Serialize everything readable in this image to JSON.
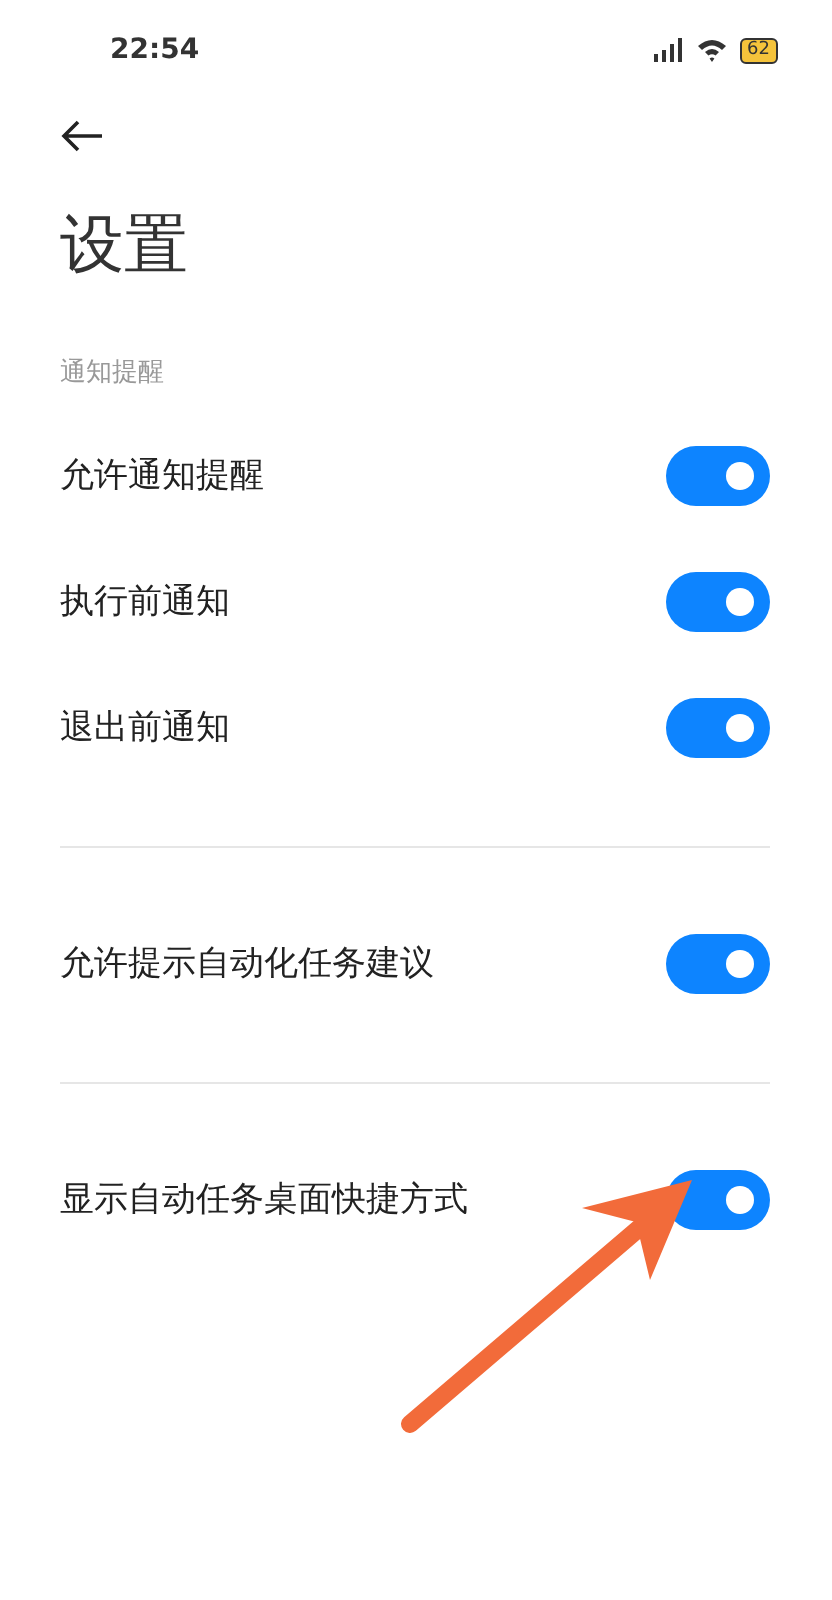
{
  "status_bar": {
    "time": "22:54",
    "battery": "62"
  },
  "title": "设置",
  "sections": [
    {
      "label": "通知提醒",
      "items": [
        {
          "label": "允许通知提醒",
          "on": true
        },
        {
          "label": "执行前通知",
          "on": true
        },
        {
          "label": "退出前通知",
          "on": true
        }
      ]
    },
    {
      "items": [
        {
          "label": "允许提示自动化任务建议",
          "on": true
        }
      ]
    },
    {
      "items": [
        {
          "label": "显示自动任务桌面快捷方式",
          "on": true
        }
      ]
    }
  ]
}
